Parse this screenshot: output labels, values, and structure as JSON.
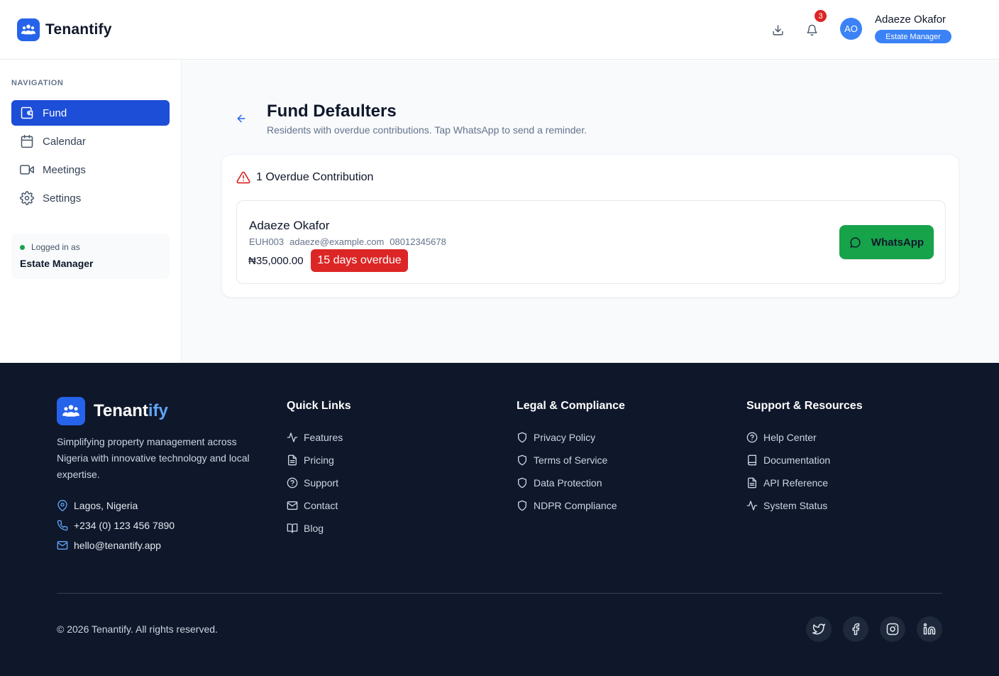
{
  "header": {
    "brand_name": "Tenantify",
    "notification_count": "3",
    "user_initials": "AO",
    "user_name": "Adaeze Okafor",
    "user_role": "Estate Manager"
  },
  "sidebar": {
    "heading": "NAVIGATION",
    "items": [
      {
        "label": "Fund",
        "icon": "wallet-icon",
        "active": true
      },
      {
        "label": "Calendar",
        "icon": "calendar-icon",
        "active": false
      },
      {
        "label": "Meetings",
        "icon": "video-icon",
        "active": false
      },
      {
        "label": "Settings",
        "icon": "gear-icon",
        "active": false
      }
    ],
    "login_label": "Logged in as",
    "login_role": "Estate Manager"
  },
  "main": {
    "title": "Fund Defaulters",
    "subtitle": "Residents with overdue contributions. Tap WhatsApp to send a reminder.",
    "card_title": "1 Overdue Contribution",
    "defaulters": [
      {
        "name": "Adaeze Okafor",
        "unit": "EUH003",
        "email": "adaeze@example.com",
        "phone": "08012345678",
        "amount": "₦35,000.00",
        "overdue": "15 days overdue",
        "action_label": "WhatsApp"
      }
    ]
  },
  "footer": {
    "brand_prefix": "Tenant",
    "brand_suffix": "ify",
    "description": "Simplifying property management across Nigeria with innovative technology and local expertise.",
    "location": "Lagos, Nigeria",
    "phone": "+234 (0) 123 456 7890",
    "email": "hello@tenantify.app",
    "quick_links": {
      "title": "Quick Links",
      "items": [
        "Features",
        "Pricing",
        "Support",
        "Contact",
        "Blog"
      ]
    },
    "legal": {
      "title": "Legal & Compliance",
      "items": [
        "Privacy Policy",
        "Terms of Service",
        "Data Protection",
        "NDPR Compliance"
      ]
    },
    "support": {
      "title": "Support & Resources",
      "items": [
        "Help Center",
        "Documentation",
        "API Reference",
        "System Status"
      ]
    },
    "copyright": "© 2026 Tenantify. All rights reserved.",
    "social": [
      "twitter-icon",
      "facebook-icon",
      "instagram-icon",
      "linkedin-icon"
    ]
  },
  "colors": {
    "primary": "#1d4ed8",
    "accent": "#3b82f6",
    "danger": "#dc2626",
    "success": "#16a34a",
    "footer_bg": "#0f172a"
  }
}
